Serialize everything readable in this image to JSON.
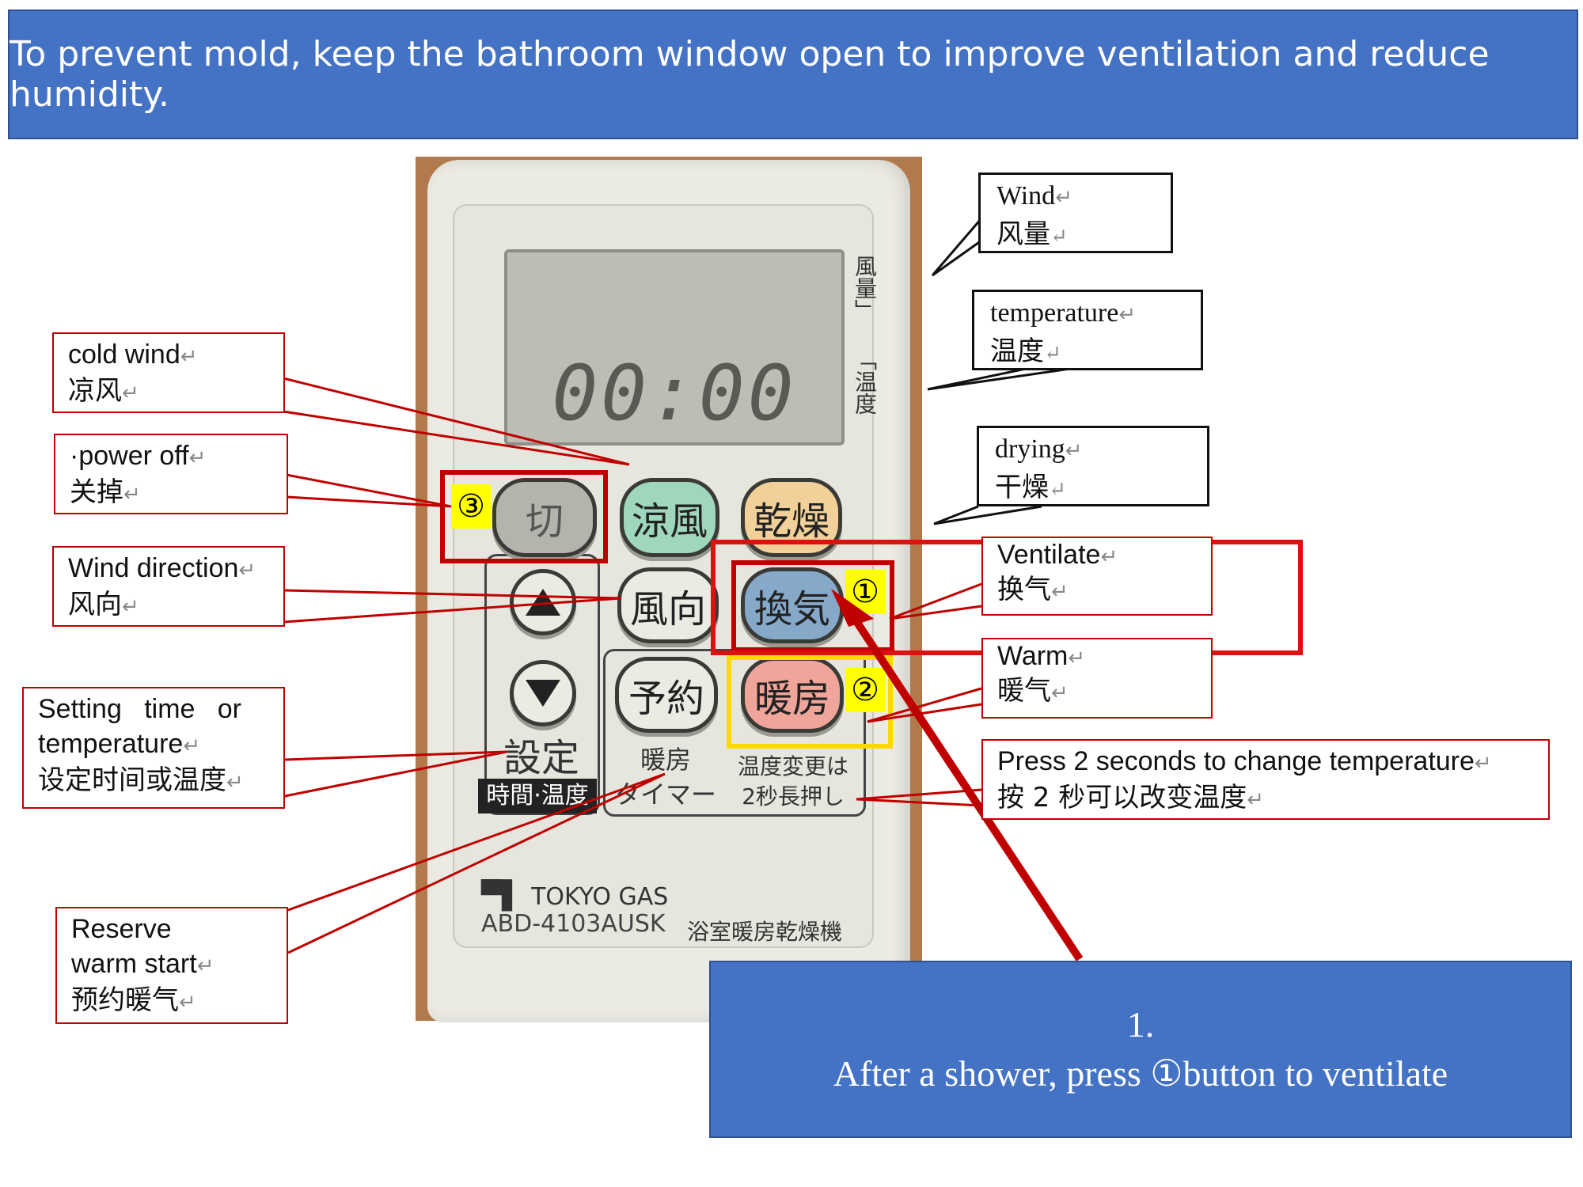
{
  "banner": {
    "text": "To prevent mold, keep the bathroom window open to improve ventilation and reduce humidity."
  },
  "remote": {
    "lcd": "00:00",
    "side_wind": "風量」",
    "side_temp": "「温度",
    "buttons": {
      "off": "切",
      "cool": "涼風",
      "dry": "乾燥",
      "direction": "風向",
      "ventilate": "換気",
      "reserve": "予約",
      "warm": "暖房"
    },
    "set_label": "設定",
    "set_sub": "時間·温度",
    "reserve_sub": "暖房\nタイマー",
    "temp_sub": "温度変更は\n2秒長押し",
    "brand": "TOKYO GAS",
    "model": "ABD-4103AUSK",
    "product": "浴室暖房乾燥機",
    "badges": {
      "one": "①",
      "two": "②",
      "three": "③"
    }
  },
  "callouts": {
    "cold_wind": {
      "en": "cold wind",
      "cn": "凉风"
    },
    "power_off": {
      "en": "·power off",
      "cn": "关掉"
    },
    "wind_direction": {
      "en": "Wind direction",
      "cn": "风向"
    },
    "setting": {
      "en1": "Setting   time   or",
      "en2": "temperature",
      "cn": "设定时间或温度"
    },
    "reserve": {
      "en1": "Reserve",
      "en2": "warm start",
      "cn": "预约暖气"
    },
    "wind": {
      "en": "Wind",
      "cn": "风量"
    },
    "temperature": {
      "en": "temperature",
      "cn": "温度"
    },
    "drying": {
      "en": "drying",
      "cn": "干燥"
    },
    "ventilate": {
      "en": "Ventilate",
      "cn": "换气"
    },
    "warm": {
      "en": "Warm",
      "cn": "暖气"
    },
    "press": {
      "en": "Press 2 seconds to change temperature",
      "cn": "按 2 秒可以改变温度"
    },
    "return_mark": "↵"
  },
  "info": {
    "line1": "1.",
    "line2": "After a shower, press ①button to ventilate"
  },
  "colors": {
    "banner": "#4472c4",
    "callout_border": "#c00000",
    "highlight_red": "#e01010",
    "highlight_yellow": "#ffd800"
  }
}
